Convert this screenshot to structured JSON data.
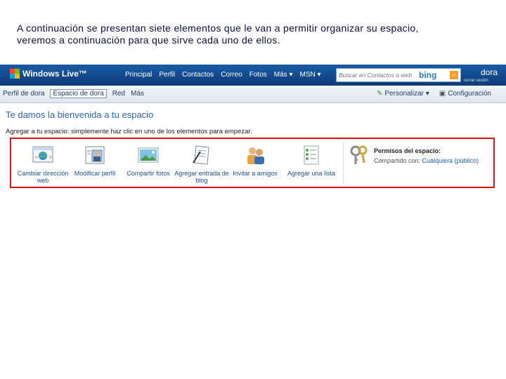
{
  "caption": {
    "line1": "A continuación se presentan siete elementos que le van a permitir organizar su espacio,",
    "line2": "veremos a continuación para que sirve cada uno de ellos."
  },
  "topbar": {
    "brand": "Windows Live™",
    "nav": [
      "Principal",
      "Perfil",
      "Contactos",
      "Correo",
      "Fotos",
      "Más ▾",
      "MSN ▾"
    ],
    "search_placeholder": "Buscar en Contactos o web",
    "search_brand": "bing",
    "user_name": "dora",
    "logout": "cerrar sesión"
  },
  "subbar": {
    "tabs": [
      "Perfil de dora",
      "Espacio de dora",
      "Red",
      "Más"
    ],
    "personalize": "Personalizar ▾",
    "configuration": "Configuración"
  },
  "main": {
    "welcome": "Te damos la bienvenida a tu espacio",
    "hint": "Agregar a tu espacio: simplemente haz clic en uno de los elementos para empezar.",
    "elements": [
      {
        "label": "Cambiar dirección web",
        "icon": "web-address-icon"
      },
      {
        "label": "Modificar perfil",
        "icon": "profile-icon"
      },
      {
        "label": "Compartir fotos",
        "icon": "photos-icon"
      },
      {
        "label": "Agregar entrada de blog",
        "icon": "blog-icon"
      },
      {
        "label": "Invitar a amigos",
        "icon": "friends-icon"
      },
      {
        "label": "Agregar una lista",
        "icon": "list-icon"
      }
    ],
    "permissions": {
      "title": "Permisos del espacio:",
      "prefix": "Compartido con:",
      "value": "Cualquiera (público)"
    }
  },
  "colors": {
    "topbar": "#12498c",
    "highlight_border": "#e01010",
    "link": "#1d4f8a"
  }
}
